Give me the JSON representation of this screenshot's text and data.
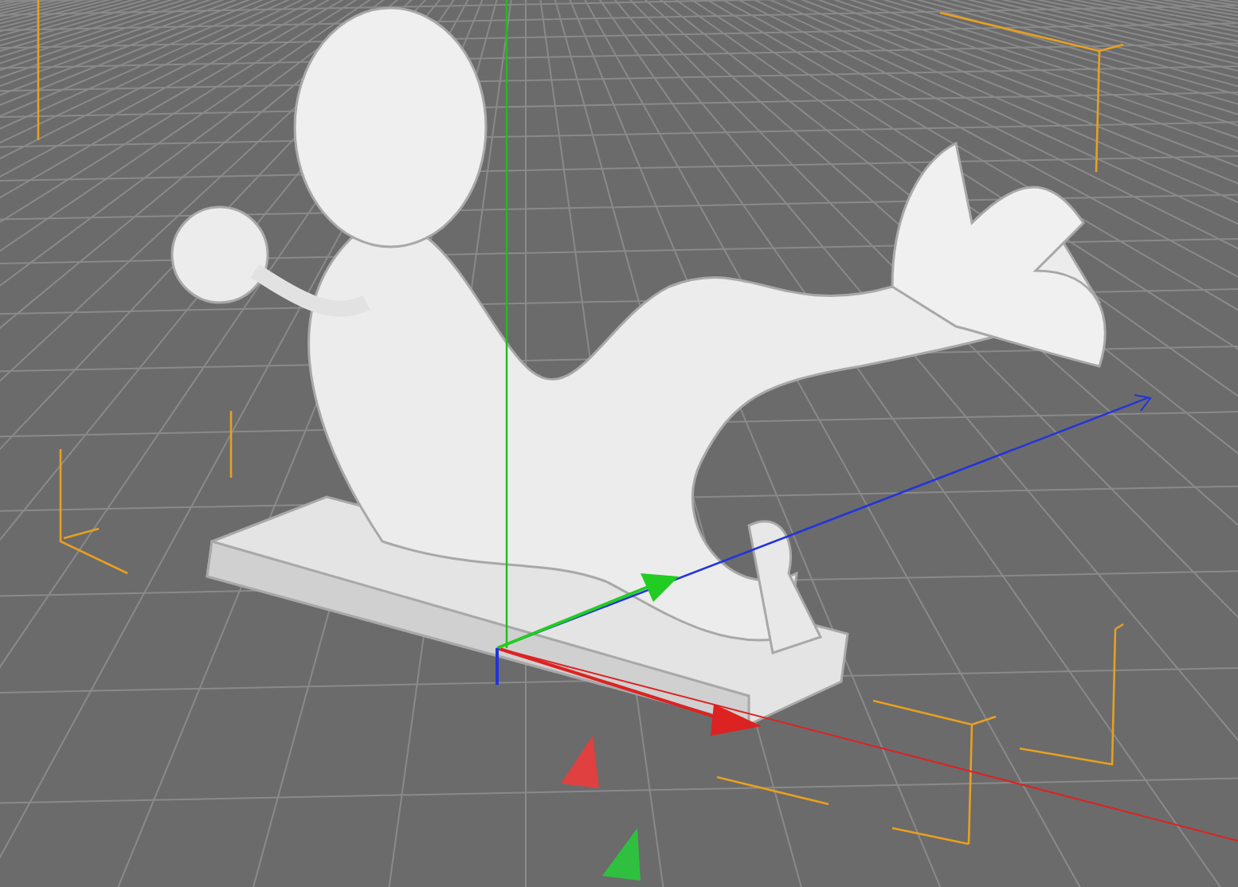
{
  "viewport": {
    "show_grid": true,
    "show_axes": true,
    "show_bounding_box": true
  }
}
